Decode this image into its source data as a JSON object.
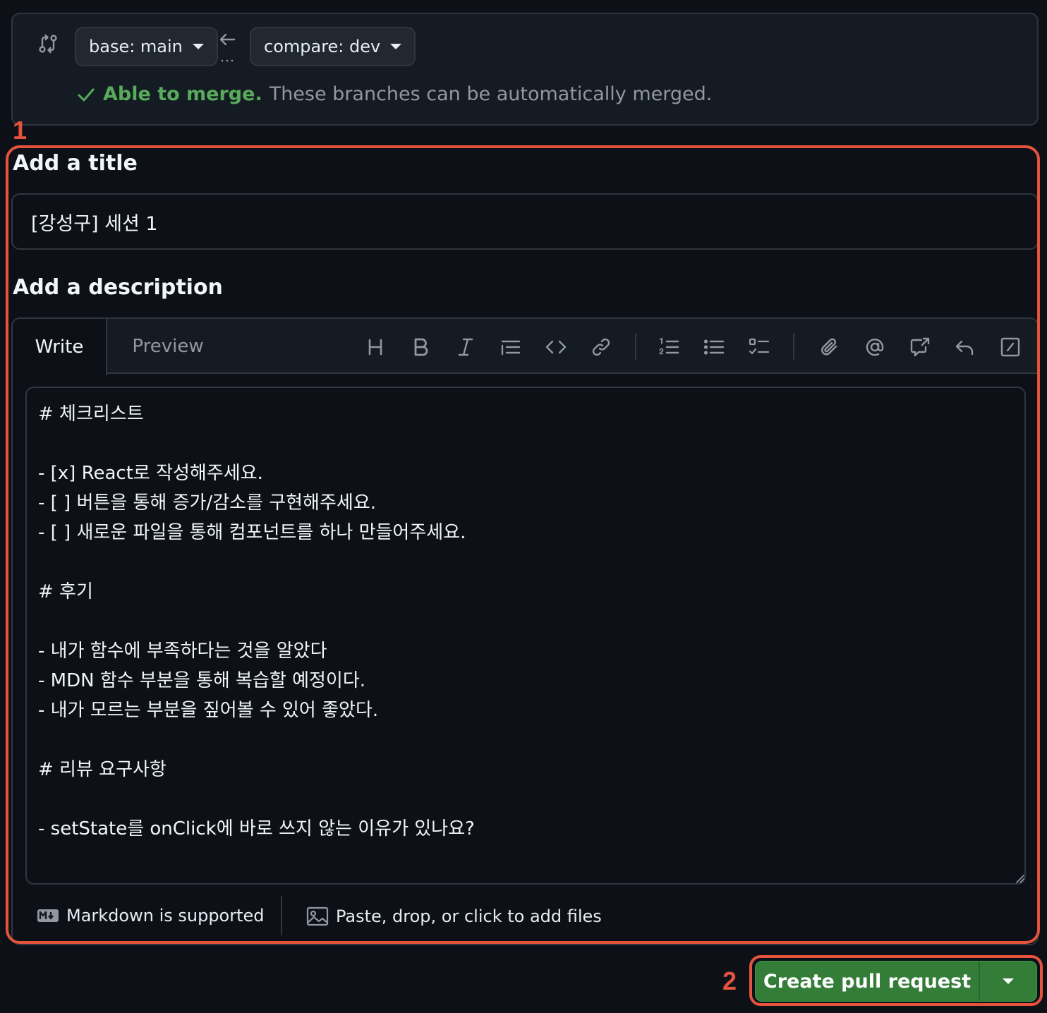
{
  "compare": {
    "base_label": "base: main",
    "compare_label": "compare: dev",
    "merge_ok": "Able to merge.",
    "merge_msg": "These branches can be automatically merged."
  },
  "annotations": {
    "one": "1",
    "two": "2"
  },
  "title_section": {
    "heading": "Add a title",
    "value": "[강성구] 세션 1"
  },
  "description_section": {
    "heading": "Add a description",
    "tabs": {
      "write": "Write",
      "preview": "Preview"
    },
    "toolbar_icons": [
      "heading-icon",
      "bold-icon",
      "italic-icon",
      "quote-icon",
      "code-icon",
      "link-icon",
      "ordered-list-icon",
      "unordered-list-icon",
      "task-list-icon",
      "attach-icon",
      "mention-icon",
      "reference-icon",
      "undo-icon",
      "slash-commands-icon"
    ],
    "body": "# 체크리스트\n\n- [x] React로 작성해주세요.\n- [ ] 버튼을 통해 증가/감소를 구현해주세요.\n- [ ] 새로운 파일을 통해 컴포넌트를 하나 만들어주세요.\n\n# 후기\n\n- 내가 함수에 부족하다는 것을 알았다\n- MDN 함수 부분을 통해 복습할 예정이다.\n- 내가 모르는 부분을 짚어볼 수 있어 좋았다.\n\n# 리뷰 요구사항\n\n- setState를 onClick에 바로 쓰지 않는 이유가 있나요?",
    "markdown_note": "Markdown is supported",
    "files_note": "Paste, drop, or click to add files"
  },
  "create": {
    "label": "Create pull request"
  },
  "colors": {
    "accent_green": "#347d39",
    "merge_green": "#57ab5a",
    "annotation_red": "#e5533d",
    "background": "#0d1117"
  }
}
